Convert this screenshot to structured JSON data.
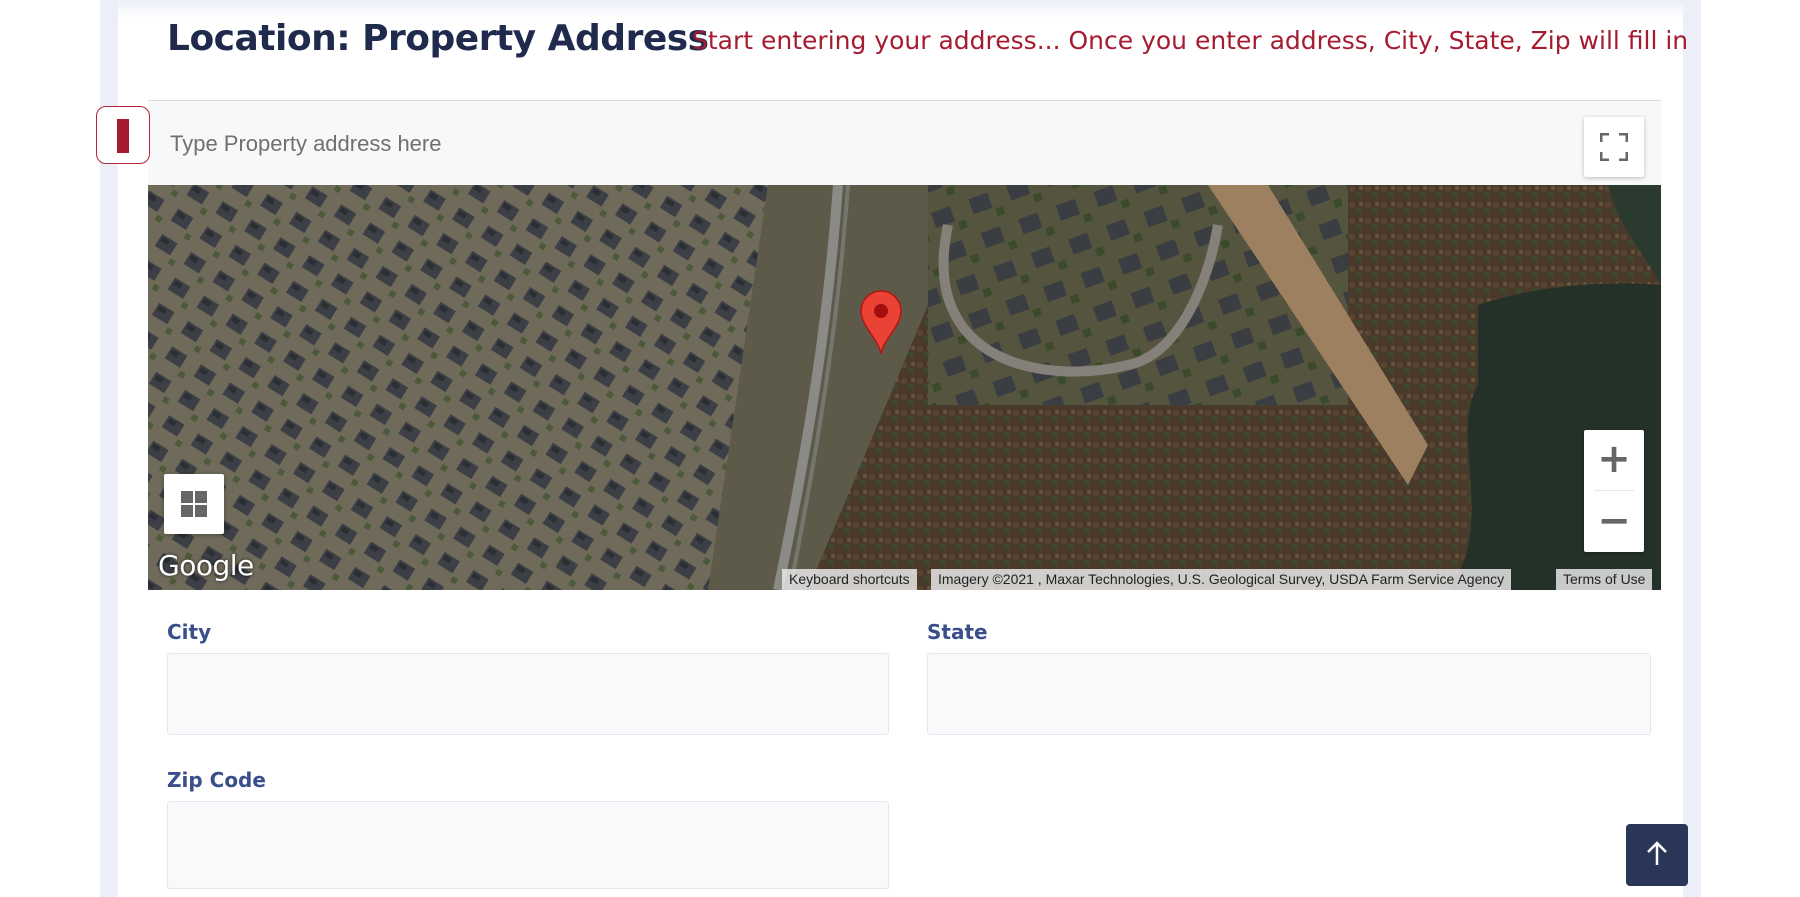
{
  "header": {
    "title": "Location: Property Address",
    "hint": "Start entering your address... Once you enter address, City, State, Zip will fill in"
  },
  "map": {
    "search_placeholder": "Type Property address here",
    "google_logo": "Google",
    "attribution": {
      "keyboard_shortcuts": "Keyboard shortcuts",
      "imagery": "Imagery ©2021 , Maxar Technologies, U.S. Geological Survey, USDA Farm Service Agency",
      "terms": "Terms of Use"
    },
    "zoom_in_label": "+",
    "zoom_out_label": "−",
    "icons": {
      "fullscreen": "fullscreen-icon",
      "layers": "map-type-icon",
      "marker": "location-pin-icon"
    },
    "colors": {
      "marker": "#ea4335"
    }
  },
  "form": {
    "city": {
      "label": "City",
      "value": ""
    },
    "state": {
      "label": "State",
      "value": ""
    },
    "zip": {
      "label": "Zip Code",
      "value": ""
    }
  },
  "colors": {
    "title": "#1f2a4d",
    "hint": "#a51c30",
    "label": "#3a4e8c",
    "scroll_button": "#293657"
  }
}
